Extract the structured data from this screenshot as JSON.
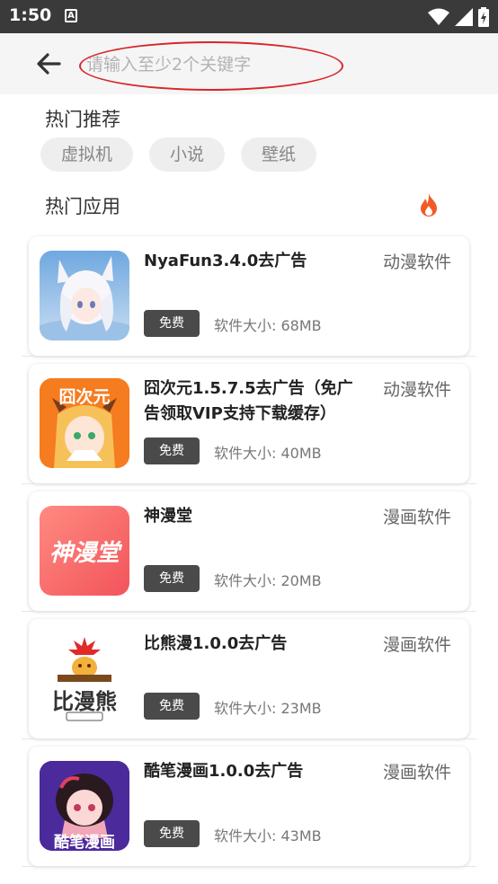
{
  "status_bar": {
    "time": "1:50",
    "notification_glyph": "A"
  },
  "search": {
    "placeholder": "请输入至少2个关键字",
    "value": ""
  },
  "hot_recommend": {
    "title": "热门推荐",
    "tags": [
      "虚拟机",
      "小说",
      "壁纸"
    ]
  },
  "hot_apps": {
    "title": "热门应用",
    "apps": [
      {
        "name": "NyaFun3.4.0去广告",
        "category": "动漫软件",
        "badge": "免费",
        "size": "软件大小: 68MB",
        "icon": "anime-fox-girl-icon",
        "icon_text": ""
      },
      {
        "name": "囧次元1.5.7.5去广告（免广告领取VIP支持下载缓存）",
        "category": "动漫软件",
        "badge": "免费",
        "size": "软件大小: 40MB",
        "icon": "jiongciyuan-icon",
        "icon_text": "囧次元"
      },
      {
        "name": "神漫堂",
        "category": "漫画软件",
        "badge": "免费",
        "size": "软件大小: 20MB",
        "icon": "shenmantang-icon",
        "icon_text": "神漫堂"
      },
      {
        "name": "比熊漫1.0.0去广告",
        "category": "漫画软件",
        "badge": "免费",
        "size": "软件大小: 23MB",
        "icon": "bixiongman-icon",
        "icon_text": "比漫熊"
      },
      {
        "name": "酷笔漫画1.0.0去广告",
        "category": "漫画软件",
        "badge": "免费",
        "size": "软件大小: 43MB",
        "icon": "kubimanhua-icon",
        "icon_text": "酷笔漫画"
      }
    ]
  },
  "colors": {
    "accent_red": "#d8262a",
    "fire": "#f15a24",
    "badge_bg": "#4a4a4a",
    "status_bar": "#3a3a3a"
  }
}
